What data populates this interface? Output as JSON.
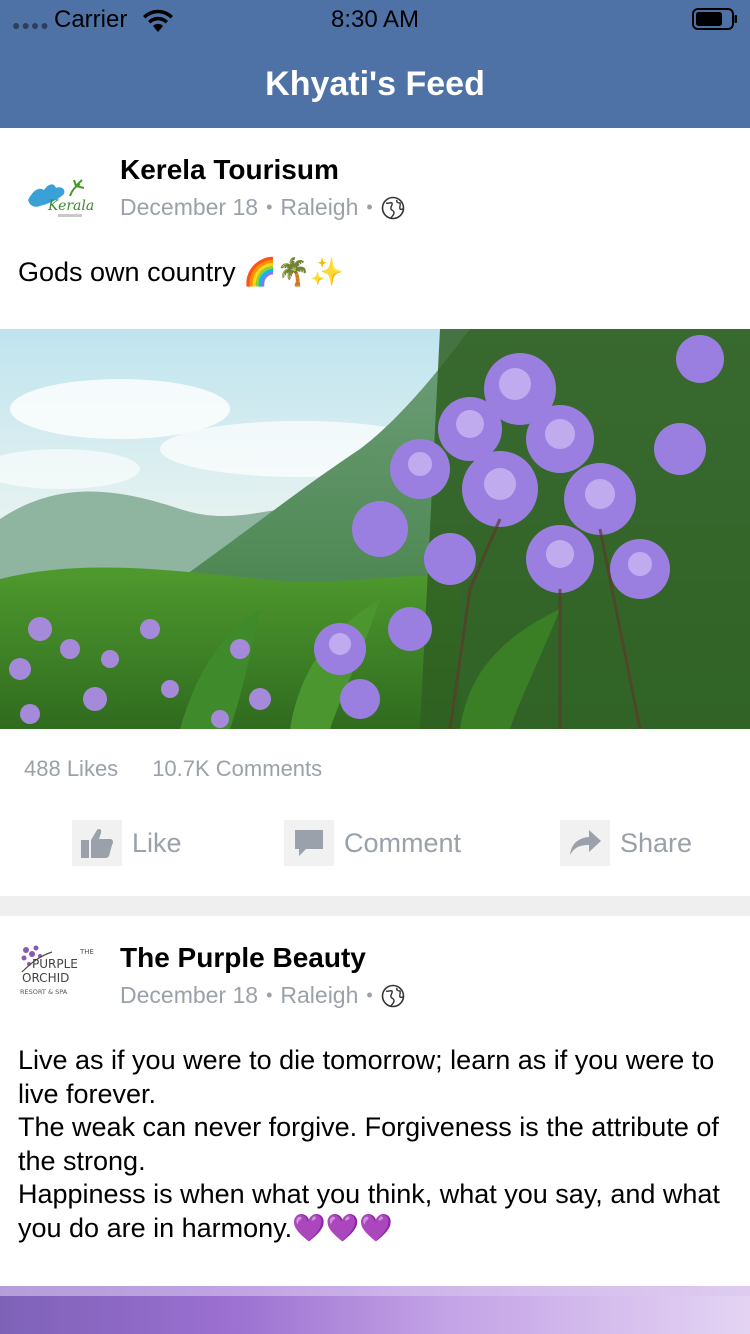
{
  "status_bar": {
    "carrier": "Carrier",
    "time": "8:30 AM"
  },
  "nav": {
    "title": "Khyati's Feed"
  },
  "posts": [
    {
      "author": "Kerela Tourisum",
      "date": "December 18",
      "location": "Raleigh",
      "separator": "•",
      "text": "Gods own country 🌈🌴✨",
      "likes": "488 Likes",
      "comments": "10.7K Comments",
      "actions": {
        "like": "Like",
        "comment": "Comment",
        "share": "Share"
      },
      "logo_text": "Kerala"
    },
    {
      "author": "The Purple Beauty",
      "date": "December 18",
      "location": "Raleigh",
      "separator": "•",
      "text": "Live as if you were to die tomorrow; learn as if you were to live forever.\nThe weak can never forgive. Forgiveness is the attribute of the strong.\nHappiness is when what you think, what you say, and what you do are in harmony.💜💜💜",
      "logo_lines": [
        "THE",
        "PURPLE",
        "ORCHID",
        "RESORT & SPA"
      ]
    }
  ],
  "icons": {
    "signal": "signal-dots-icon",
    "wifi": "wifi-icon",
    "battery": "battery-icon",
    "globe": "globe-icon",
    "like": "thumbs-up-icon",
    "comment": "comment-bubble-icon",
    "share": "share-arrow-icon"
  },
  "colors": {
    "nav_bar": "#4e72a6",
    "meta_text": "#9aa1aa",
    "separator_gap": "#efefef"
  }
}
